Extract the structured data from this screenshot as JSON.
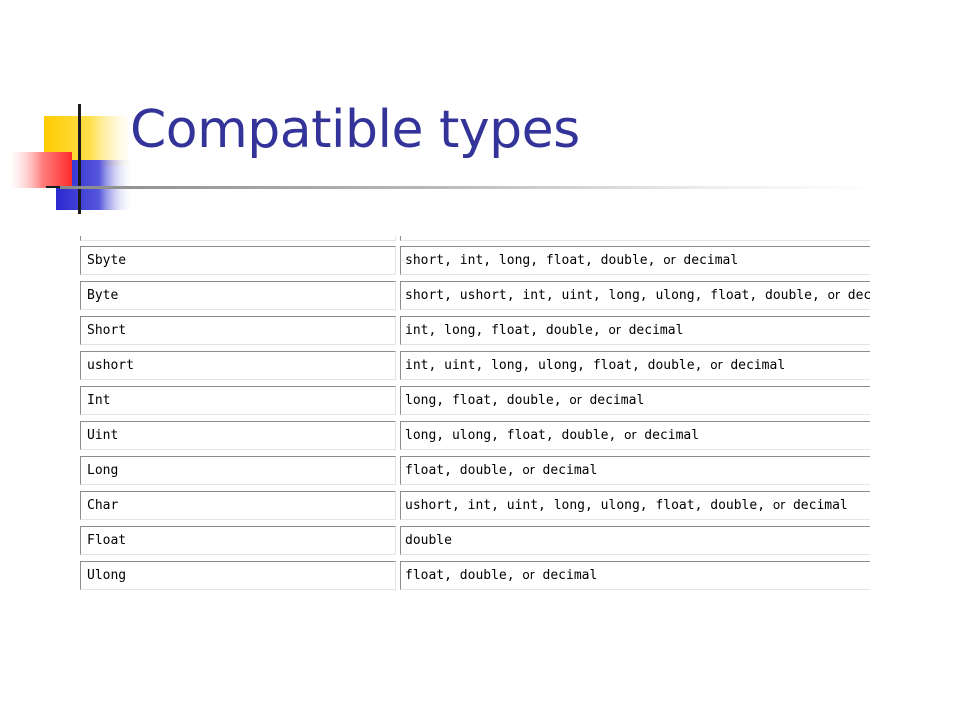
{
  "slide": {
    "title": "Compatible types"
  },
  "table": {
    "rows": [
      {
        "type": "Sbyte",
        "compatible": [
          "short, int, long, float, double, ",
          "or",
          " decimal"
        ]
      },
      {
        "type": "Byte",
        "compatible": [
          "short, ushort, int, uint, long, ulong, float, double, ",
          "or",
          " decimal"
        ]
      },
      {
        "type": "Short",
        "compatible": [
          "int, long, float, double, ",
          "or",
          " decimal"
        ]
      },
      {
        "type": "ushort",
        "compatible": [
          "int, uint, long, ulong, float, double, ",
          "or",
          " decimal"
        ]
      },
      {
        "type": "Int",
        "compatible": [
          "long, float, double, ",
          "or",
          " decimal"
        ]
      },
      {
        "type": "Uint",
        "compatible": [
          "long, ulong, float, double, ",
          "or",
          " decimal"
        ]
      },
      {
        "type": "Long",
        "compatible": [
          "float, double, ",
          "or",
          " decimal"
        ]
      },
      {
        "type": "Char",
        "compatible": [
          "ushort, int, uint, long, ulong, float, double, ",
          "or",
          " decimal"
        ]
      },
      {
        "type": "Float",
        "compatible": [
          "double",
          "",
          ""
        ]
      },
      {
        "type": "Ulong",
        "compatible": [
          "float, double, ",
          "or",
          " decimal"
        ]
      }
    ]
  },
  "colors": {
    "title": "#333399",
    "deco_yellow": "#ffcc00",
    "deco_blue": "#3333cc",
    "deco_red": "#ff3333"
  }
}
